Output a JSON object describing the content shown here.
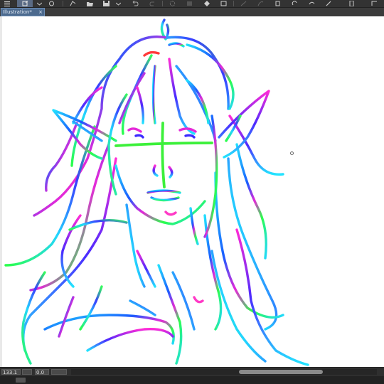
{
  "document": {
    "tab_title": "Illustration*",
    "tab_close": "×"
  },
  "toolbar": {
    "icons": [
      "menu-icon",
      "new-icon",
      "chevron-down-icon",
      "layer-icon",
      "snap-icon",
      "open-folder-icon",
      "save-icon",
      "chevron-down-icon",
      "undo-icon",
      "redo-icon",
      "transform-icon",
      "select-icon",
      "fill-icon",
      "crop-icon",
      "ruler-icon",
      "correct-line-icon",
      "eraser-icon",
      "clip-icon",
      "device-icon",
      "tablet-icon"
    ]
  },
  "status": {
    "zoom": "133.1",
    "rotation": "0.0"
  },
  "colors": {
    "accent": "#4c6a8e",
    "toolbar_bg": "#333333",
    "canvas_bg": "#ffffff"
  }
}
